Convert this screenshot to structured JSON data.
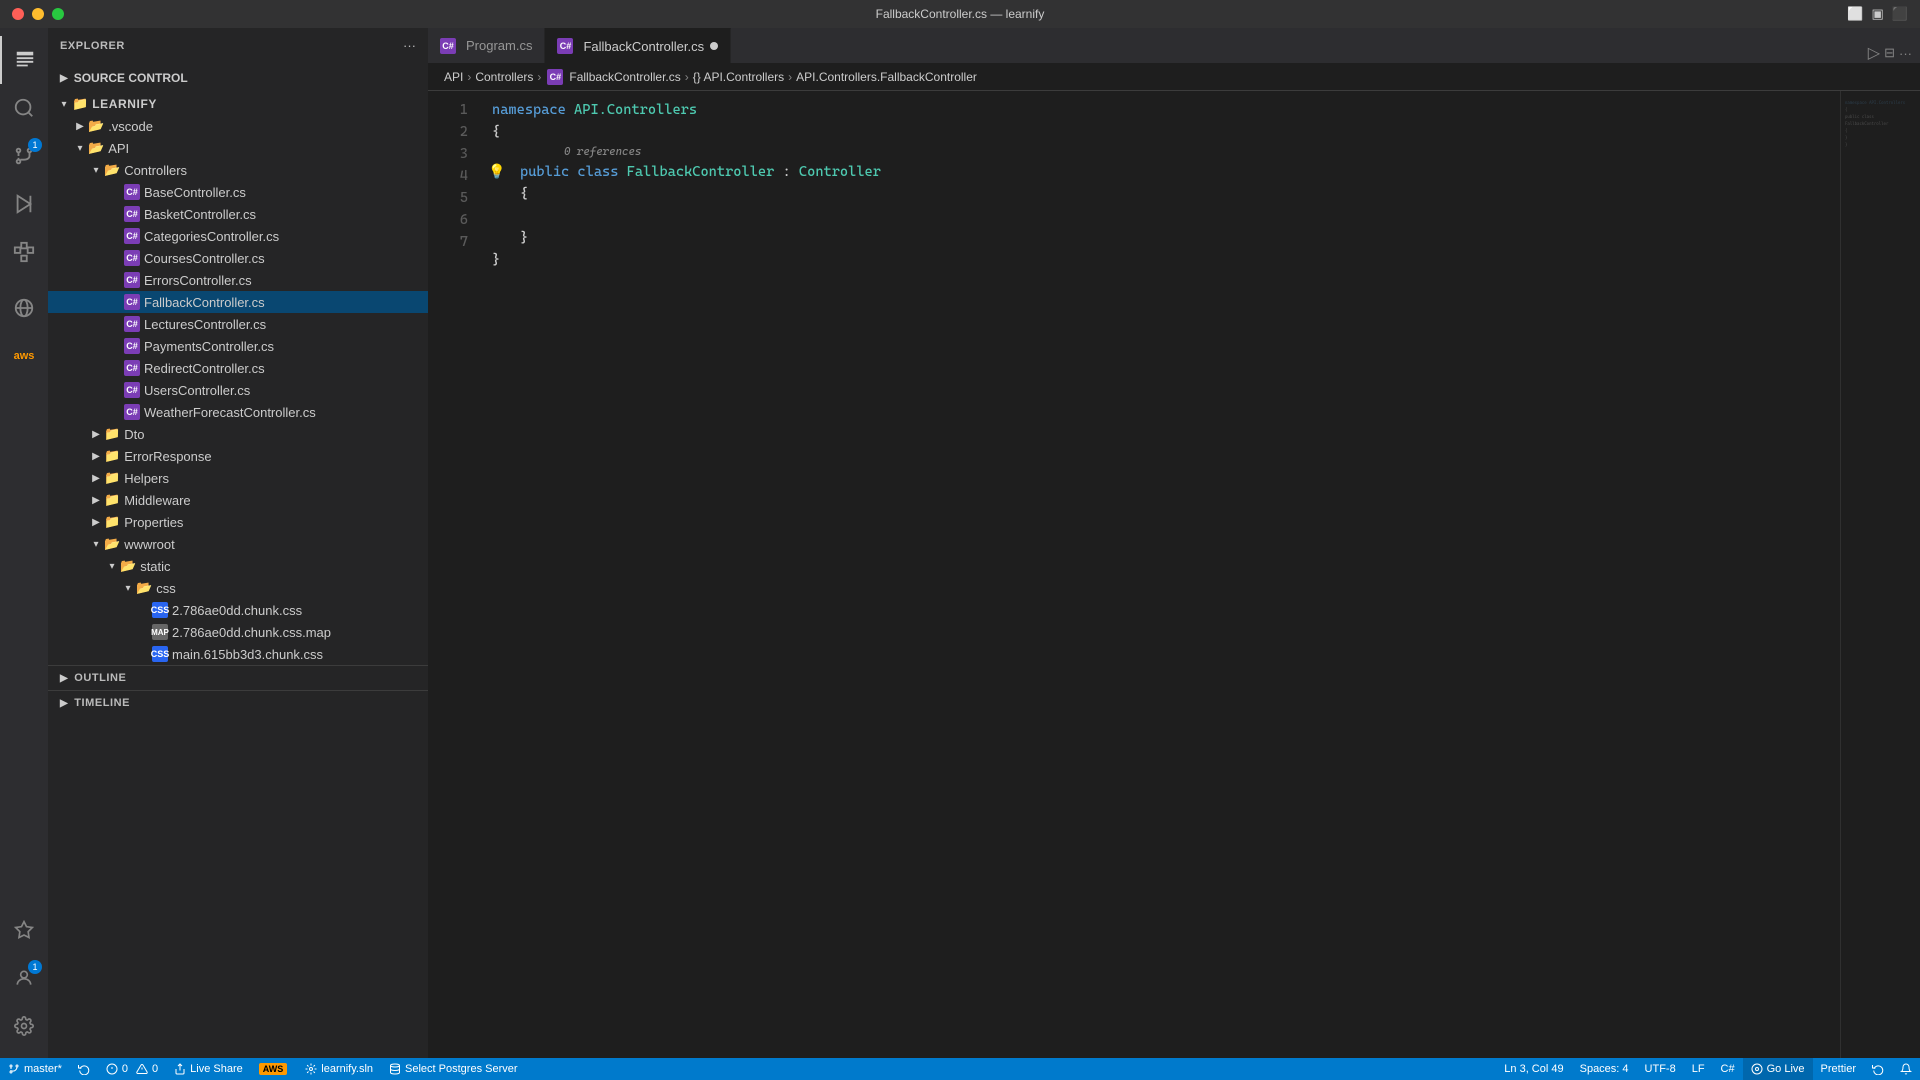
{
  "titleBar": {
    "title": "FallbackController.cs — learnify",
    "controls": [
      "close",
      "minimize",
      "maximize"
    ]
  },
  "activityBar": {
    "icons": [
      {
        "name": "explorer",
        "label": "Explorer",
        "symbol": "⊞",
        "active": true,
        "badge": null
      },
      {
        "name": "search",
        "label": "Search",
        "symbol": "🔍",
        "active": false
      },
      {
        "name": "source-control",
        "label": "Source Control",
        "symbol": "⎇",
        "active": false,
        "badge": "1"
      },
      {
        "name": "run",
        "label": "Run and Debug",
        "symbol": "▷",
        "active": false
      },
      {
        "name": "extensions",
        "label": "Extensions",
        "symbol": "⊡",
        "active": false
      },
      {
        "name": "remote",
        "label": "Remote Explorer",
        "symbol": "◯",
        "active": false
      },
      {
        "name": "aws",
        "label": "AWS",
        "symbol": "aws",
        "active": false
      }
    ],
    "bottomIcons": [
      {
        "name": "live-share",
        "symbol": "⬡",
        "active": false
      },
      {
        "name": "accounts",
        "symbol": "👤",
        "badge": "1"
      },
      {
        "name": "settings",
        "symbol": "⚙"
      }
    ]
  },
  "sidebar": {
    "title": "EXPLORER",
    "moreButton": "...",
    "sourceControl": {
      "label": "SOURCE CONTROL"
    },
    "explorer": {
      "rootLabel": "LEARNIFY",
      "items": [
        {
          "id": "vscode",
          "type": "folder",
          "label": ".vscode",
          "depth": 1,
          "collapsed": true
        },
        {
          "id": "api",
          "type": "folder",
          "label": "API",
          "depth": 1,
          "collapsed": false,
          "color": "default"
        },
        {
          "id": "controllers",
          "type": "folder",
          "label": "Controllers",
          "depth": 2,
          "collapsed": false,
          "color": "default"
        },
        {
          "id": "BaseController.cs",
          "type": "cs",
          "label": "BaseController.cs",
          "depth": 3
        },
        {
          "id": "BasketController.cs",
          "type": "cs",
          "label": "BasketController.cs",
          "depth": 3
        },
        {
          "id": "CategoriesController.cs",
          "type": "cs",
          "label": "CategoriesController.cs",
          "depth": 3
        },
        {
          "id": "CoursesController.cs",
          "type": "cs",
          "label": "CoursesController.cs",
          "depth": 3
        },
        {
          "id": "ErrorsController.cs",
          "type": "cs",
          "label": "ErrorsController.cs",
          "depth": 3
        },
        {
          "id": "FallbackController.cs",
          "type": "cs",
          "label": "FallbackController.cs",
          "depth": 3,
          "active": true
        },
        {
          "id": "LecturesController.cs",
          "type": "cs",
          "label": "LecturesController.cs",
          "depth": 3
        },
        {
          "id": "PaymentsController.cs",
          "type": "cs",
          "label": "PaymentsController.cs",
          "depth": 3
        },
        {
          "id": "RedirectController.cs",
          "type": "cs",
          "label": "RedirectController.cs",
          "depth": 3
        },
        {
          "id": "UsersController.cs",
          "type": "cs",
          "label": "UsersController.cs",
          "depth": 3
        },
        {
          "id": "WeatherForecastController.cs",
          "type": "cs",
          "label": "WeatherForecastController.cs",
          "depth": 3
        },
        {
          "id": "Dto",
          "type": "folder",
          "label": "Dto",
          "depth": 2,
          "collapsed": true,
          "color": "default"
        },
        {
          "id": "ErrorResponse",
          "type": "folder",
          "label": "ErrorResponse",
          "depth": 2,
          "collapsed": true,
          "color": "default"
        },
        {
          "id": "Helpers",
          "type": "folder",
          "label": "Helpers",
          "depth": 2,
          "collapsed": true,
          "color": "default"
        },
        {
          "id": "Middleware",
          "type": "folder",
          "label": "Middleware",
          "depth": 2,
          "collapsed": true,
          "color": "purple"
        },
        {
          "id": "Properties",
          "type": "folder",
          "label": "Properties",
          "depth": 2,
          "collapsed": true,
          "color": "default"
        },
        {
          "id": "wwwroot",
          "type": "folder",
          "label": "wwwroot",
          "depth": 2,
          "collapsed": false,
          "color": "blue"
        },
        {
          "id": "static",
          "type": "folder",
          "label": "static",
          "depth": 3,
          "collapsed": false,
          "color": "blue"
        },
        {
          "id": "css",
          "type": "folder",
          "label": "css",
          "depth": 4,
          "collapsed": false,
          "color": "blue"
        },
        {
          "id": "2.786ae0dd.chunk.css",
          "type": "css",
          "label": "2.786ae0dd.chunk.css",
          "depth": 5
        },
        {
          "id": "2.786ae0dd.chunk.css.map",
          "type": "map",
          "label": "2.786ae0dd.chunk.css.map",
          "depth": 5
        },
        {
          "id": "main.615bb3d3.chunk.css",
          "type": "css",
          "label": "main.615bb3d3.chunk.css",
          "depth": 5
        }
      ]
    },
    "outline": {
      "label": "OUTLINE"
    },
    "timeline": {
      "label": "TIMELINE"
    }
  },
  "tabs": [
    {
      "id": "program",
      "label": "Program.cs",
      "type": "cs",
      "active": false,
      "dirty": false
    },
    {
      "id": "fallback",
      "label": "FallbackController.cs",
      "type": "cs",
      "active": true,
      "dirty": true
    }
  ],
  "breadcrumb": [
    "API",
    "Controllers",
    "FallbackController.cs",
    "{} API.Controllers",
    "API.Controllers.FallbackController"
  ],
  "code": {
    "lines": [
      {
        "num": 1,
        "tokens": [
          {
            "type": "kw",
            "text": "namespace"
          },
          {
            "type": "plain",
            "text": " "
          },
          {
            "type": "ns",
            "text": "API.Controllers"
          }
        ]
      },
      {
        "num": 2,
        "tokens": [
          {
            "type": "punct",
            "text": "{"
          }
        ]
      },
      {
        "num": 3,
        "hint": "0 references",
        "lightbulb": true,
        "tokens": [
          {
            "type": "plain",
            "text": "    "
          },
          {
            "type": "kw",
            "text": "public"
          },
          {
            "type": "plain",
            "text": " "
          },
          {
            "type": "kw",
            "text": "class"
          },
          {
            "type": "plain",
            "text": " "
          },
          {
            "type": "type",
            "text": "FallbackController"
          },
          {
            "type": "plain",
            "text": " : "
          },
          {
            "type": "type",
            "text": "Controller"
          }
        ]
      },
      {
        "num": 4,
        "tokens": [
          {
            "type": "plain",
            "text": "    "
          },
          {
            "type": "punct",
            "text": "{"
          }
        ]
      },
      {
        "num": 5,
        "tokens": []
      },
      {
        "num": 6,
        "tokens": [
          {
            "type": "plain",
            "text": "    "
          },
          {
            "type": "punct",
            "text": "}"
          }
        ]
      },
      {
        "num": 7,
        "tokens": [
          {
            "type": "punct",
            "text": "}"
          }
        ]
      }
    ]
  },
  "statusBar": {
    "left": [
      {
        "id": "branch",
        "icon": "⎇",
        "label": "master*"
      },
      {
        "id": "sync",
        "icon": "↻",
        "label": ""
      },
      {
        "id": "errors",
        "icon": "⊘",
        "label": "0"
      },
      {
        "id": "warnings",
        "icon": "⚠",
        "label": "0"
      },
      {
        "id": "liveshare",
        "icon": "⬡",
        "label": "Live Share"
      },
      {
        "id": "aws",
        "label": "AWS"
      },
      {
        "id": "learnify",
        "icon": "◎",
        "label": "learnify.sln"
      },
      {
        "id": "db",
        "icon": "⬡",
        "label": "Select Postgres Server"
      }
    ],
    "right": [
      {
        "id": "position",
        "label": "Ln 3, Col 49"
      },
      {
        "id": "spaces",
        "label": "Spaces: 4"
      },
      {
        "id": "encoding",
        "label": "UTF-8"
      },
      {
        "id": "eol",
        "label": "LF"
      },
      {
        "id": "language",
        "label": "C#"
      },
      {
        "id": "golive",
        "label": "Go Live"
      },
      {
        "id": "prettier",
        "label": "Prettier"
      },
      {
        "id": "sync-icon",
        "label": "⟳"
      },
      {
        "id": "bell",
        "label": "🔔"
      }
    ]
  }
}
